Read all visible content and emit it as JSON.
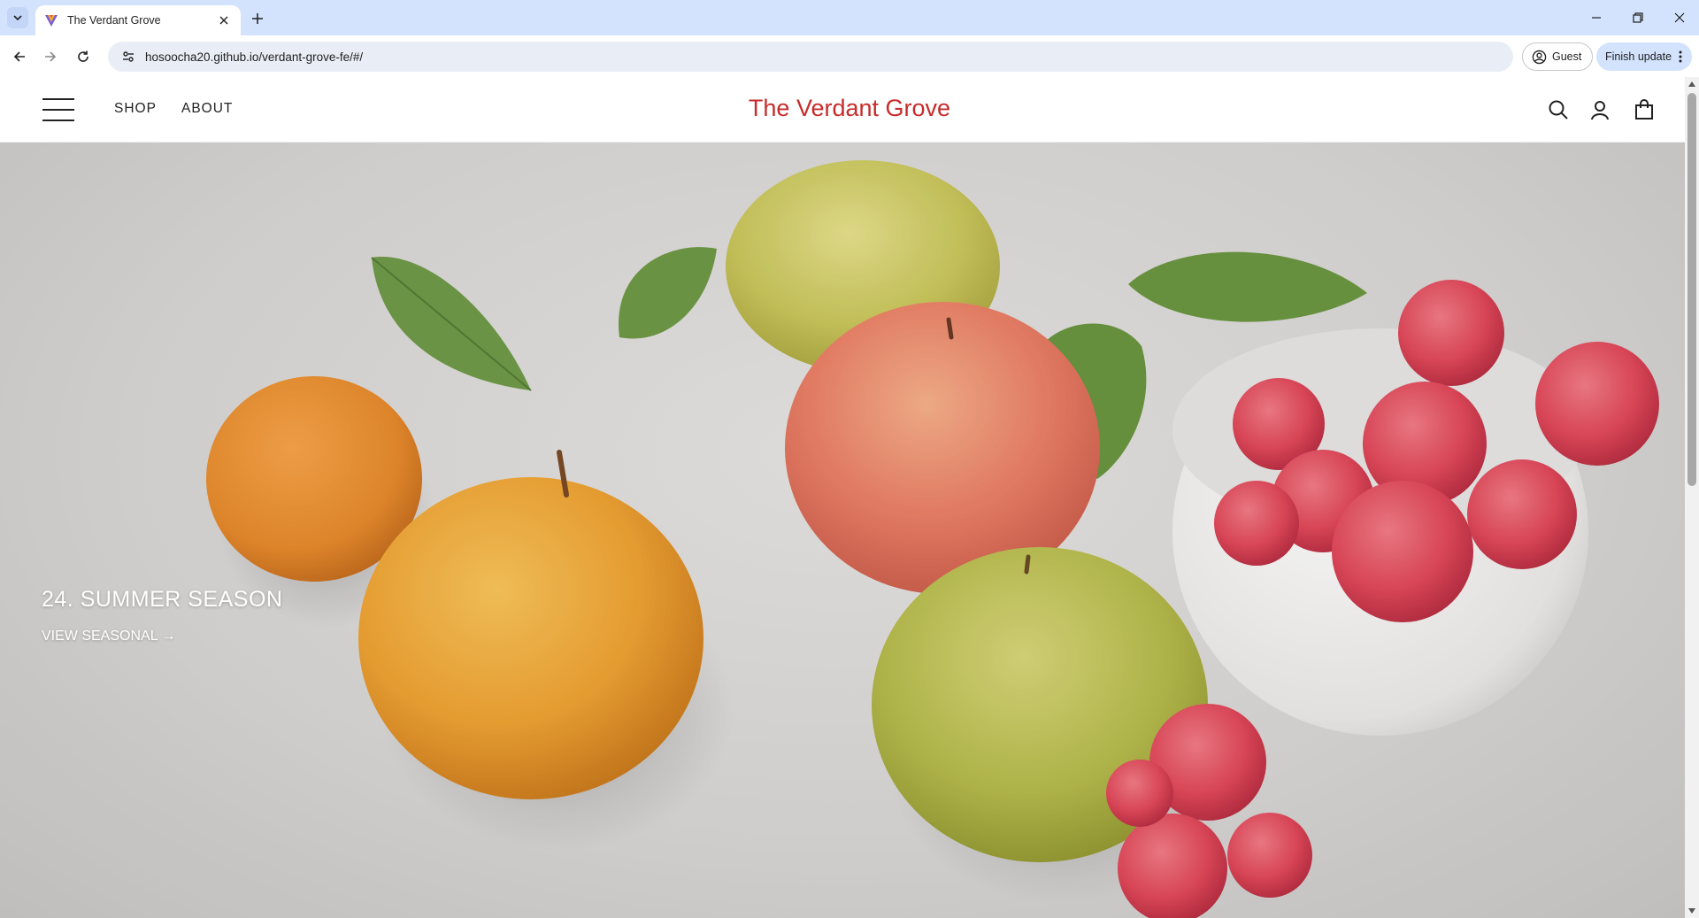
{
  "browser": {
    "tab": {
      "title": "The Verdant Grove",
      "favicon": "verdant-grove-favicon"
    },
    "url": "hosoocha20.github.io/verdant-grove-fe/#/",
    "profile_label": "Guest",
    "update_label": "Finish update",
    "colors": {
      "tabstrip": "#d3e3fd",
      "omnibox": "#e9eef6"
    }
  },
  "site": {
    "brand": "The Verdant Grove",
    "nav": {
      "shop": "SHOP",
      "about": "ABOUT"
    },
    "icons": [
      "menu-icon",
      "search-icon",
      "account-icon",
      "shopping-bag-icon"
    ],
    "colors": {
      "brand": "#c72b2b",
      "text": "#222222"
    }
  },
  "hero": {
    "title": "24. SUMMER SEASON",
    "link_label": "VIEW SEASONAL →"
  }
}
